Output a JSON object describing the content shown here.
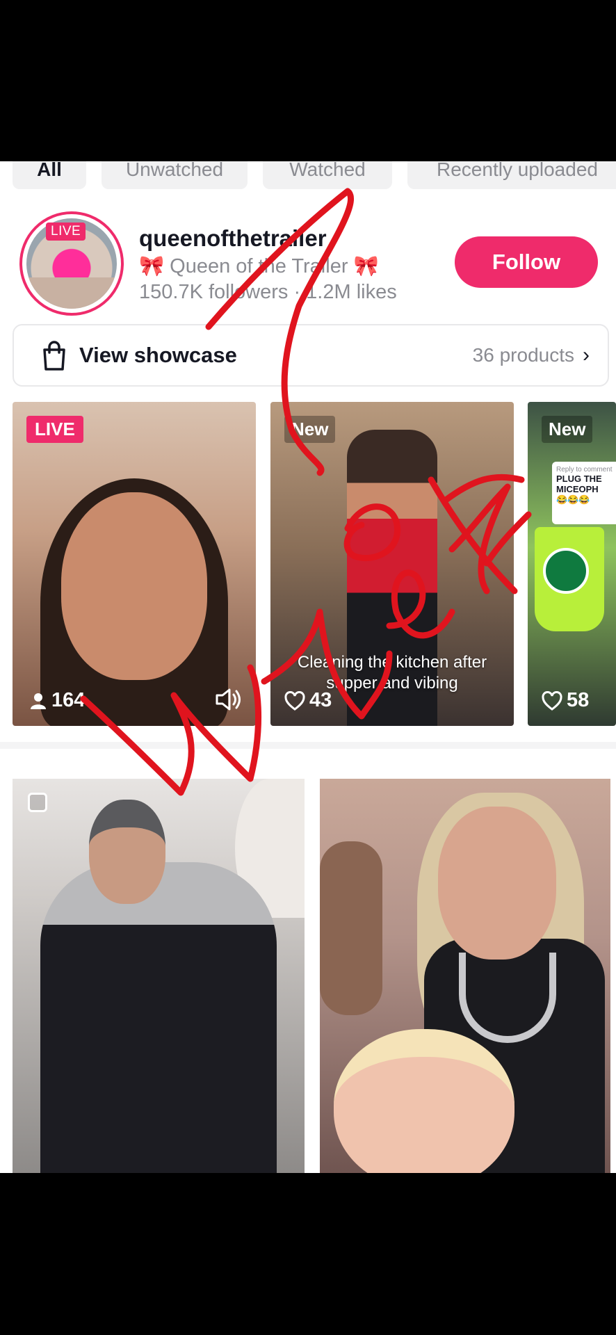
{
  "filters": [
    {
      "label": "All",
      "active": true
    },
    {
      "label": "Unwatched",
      "active": false
    },
    {
      "label": "Watched",
      "active": false
    },
    {
      "label": "Recently uploaded",
      "active": false
    }
  ],
  "profile": {
    "avatar_badge": "LIVE",
    "username": "queenofthetrailer",
    "subtitle": "🎀 Queen of the Trailer 🎀",
    "stats": "150.7K followers · 1.2M likes",
    "follow_label": "Follow"
  },
  "showcase": {
    "label": "View showcase",
    "products": "36 products"
  },
  "videos": [
    {
      "badge": "LIVE",
      "viewers": "164"
    },
    {
      "badge": "New",
      "caption": "Cleaning the kitchen after supper and vibing",
      "likes": "43"
    },
    {
      "badge": "New",
      "likes": "58",
      "comment_heading": "Reply to comment",
      "comment_text": "PLUG THE MICEOPH",
      "comment_emoji": "😂😂😂"
    }
  ],
  "annotation": {
    "text": "What",
    "color": "#e0141e"
  },
  "colors": {
    "accent": "#ef2b6b",
    "text": "#161823",
    "secondary": "#8a8b91"
  },
  "icons": [
    "shopping-bag-icon",
    "chevron-right-icon",
    "person-icon",
    "speaker-icon",
    "heart-icon",
    "checkbox-icon"
  ]
}
